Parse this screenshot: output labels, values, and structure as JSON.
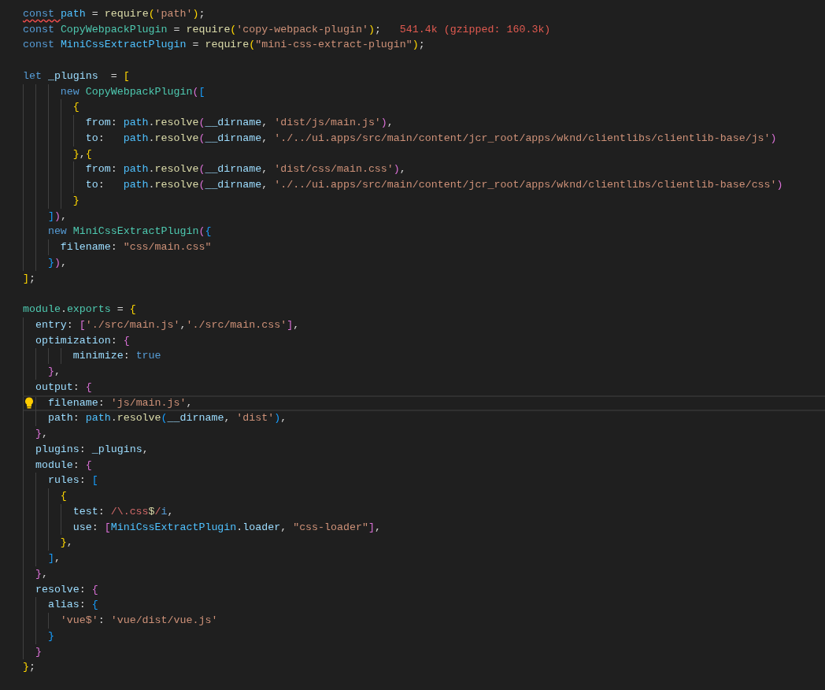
{
  "editor": {
    "blocks": [
      {
        "lines": [
          {
            "tokens": [
              {
                "text": "const ",
                "kind": "kw",
                "error": true
              },
              {
                "text": "path",
                "kind": "cvar"
              },
              {
                "text": " = ",
                "kind": "p"
              },
              {
                "text": "require",
                "kind": "fn"
              },
              {
                "text": "(",
                "kind": "y"
              },
              {
                "text": "'path'",
                "kind": "str"
              },
              {
                "text": ")",
                "kind": "y"
              },
              {
                "text": ";",
                "kind": "p"
              }
            ]
          },
          {
            "tokens": [
              {
                "text": "const ",
                "kind": "kw"
              },
              {
                "text": "CopyWebpackPlugin",
                "kind": "cls"
              },
              {
                "text": " = ",
                "kind": "p"
              },
              {
                "text": "require",
                "kind": "fn"
              },
              {
                "text": "(",
                "kind": "y"
              },
              {
                "text": "'copy-webpack-plugin'",
                "kind": "str"
              },
              {
                "text": ")",
                "kind": "y"
              },
              {
                "text": ";",
                "kind": "p"
              }
            ],
            "annotation": "541.4k (gzipped: 160.3k)"
          },
          {
            "tokens": [
              {
                "text": "const ",
                "kind": "kw"
              },
              {
                "text": "MiniCssExtractPlugin",
                "kind": "cvar"
              },
              {
                "text": " = ",
                "kind": "p"
              },
              {
                "text": "require",
                "kind": "fn"
              },
              {
                "text": "(",
                "kind": "y"
              },
              {
                "text": "\"mini-css-extract-plugin\"",
                "kind": "str"
              },
              {
                "text": ")",
                "kind": "y"
              },
              {
                "text": ";",
                "kind": "p"
              }
            ]
          }
        ]
      },
      {
        "lines": [
          {
            "tokens": [
              {
                "text": "let ",
                "kind": "kw"
              },
              {
                "text": "_plugins",
                "kind": "prop"
              },
              {
                "text": "  = ",
                "kind": "p"
              },
              {
                "text": "[",
                "kind": "y"
              }
            ]
          },
          {
            "tokens": [
              {
                "text": "      new ",
                "kind": "kw"
              },
              {
                "text": "CopyWebpackPlugin",
                "kind": "cls"
              },
              {
                "text": "(",
                "kind": "m"
              },
              {
                "text": "[",
                "kind": "b"
              }
            ]
          },
          {
            "tokens": [
              {
                "text": "        {",
                "kind": "y"
              }
            ]
          },
          {
            "tokens": [
              {
                "text": "          from",
                "kind": "prop"
              },
              {
                "text": ": ",
                "kind": "p"
              },
              {
                "text": "path",
                "kind": "cvar"
              },
              {
                "text": ".",
                "kind": "p"
              },
              {
                "text": "resolve",
                "kind": "fn"
              },
              {
                "text": "(",
                "kind": "m"
              },
              {
                "text": "__dirname",
                "kind": "prop"
              },
              {
                "text": ", ",
                "kind": "p"
              },
              {
                "text": "'dist/js/main.js'",
                "kind": "str"
              },
              {
                "text": ")",
                "kind": "m"
              },
              {
                "text": ",",
                "kind": "p"
              }
            ]
          },
          {
            "tokens": [
              {
                "text": "          to",
                "kind": "prop"
              },
              {
                "text": ":   ",
                "kind": "p"
              },
              {
                "text": "path",
                "kind": "cvar"
              },
              {
                "text": ".",
                "kind": "p"
              },
              {
                "text": "resolve",
                "kind": "fn"
              },
              {
                "text": "(",
                "kind": "m"
              },
              {
                "text": "__dirname",
                "kind": "prop"
              },
              {
                "text": ", ",
                "kind": "p"
              },
              {
                "text": "'./../ui.apps/src/main/content/jcr_root/apps/wknd/clientlibs/clientlib-base/js'",
                "kind": "str"
              },
              {
                "text": ")",
                "kind": "m"
              }
            ]
          },
          {
            "tokens": [
              {
                "text": "        }",
                "kind": "y"
              },
              {
                "text": ",",
                "kind": "p"
              },
              {
                "text": "{",
                "kind": "y"
              }
            ]
          },
          {
            "tokens": [
              {
                "text": "          from",
                "kind": "prop"
              },
              {
                "text": ": ",
                "kind": "p"
              },
              {
                "text": "path",
                "kind": "cvar"
              },
              {
                "text": ".",
                "kind": "p"
              },
              {
                "text": "resolve",
                "kind": "fn"
              },
              {
                "text": "(",
                "kind": "m"
              },
              {
                "text": "__dirname",
                "kind": "prop"
              },
              {
                "text": ", ",
                "kind": "p"
              },
              {
                "text": "'dist/css/main.css'",
                "kind": "str"
              },
              {
                "text": ")",
                "kind": "m"
              },
              {
                "text": ",",
                "kind": "p"
              }
            ]
          },
          {
            "tokens": [
              {
                "text": "          to",
                "kind": "prop"
              },
              {
                "text": ":   ",
                "kind": "p"
              },
              {
                "text": "path",
                "kind": "cvar"
              },
              {
                "text": ".",
                "kind": "p"
              },
              {
                "text": "resolve",
                "kind": "fn"
              },
              {
                "text": "(",
                "kind": "m"
              },
              {
                "text": "__dirname",
                "kind": "prop"
              },
              {
                "text": ", ",
                "kind": "p"
              },
              {
                "text": "'./../ui.apps/src/main/content/jcr_root/apps/wknd/clientlibs/clientlib-base/css'",
                "kind": "str"
              },
              {
                "text": ")",
                "kind": "m"
              }
            ]
          },
          {
            "tokens": [
              {
                "text": "        }",
                "kind": "y"
              }
            ]
          },
          {
            "tokens": [
              {
                "text": "    ]",
                "kind": "b"
              },
              {
                "text": ")",
                "kind": "m"
              },
              {
                "text": ",",
                "kind": "p"
              }
            ]
          },
          {
            "tokens": [
              {
                "text": "    new ",
                "kind": "kw"
              },
              {
                "text": "MiniCssExtractPlugin",
                "kind": "cls"
              },
              {
                "text": "(",
                "kind": "m"
              },
              {
                "text": "{",
                "kind": "b"
              }
            ]
          },
          {
            "tokens": [
              {
                "text": "      filename",
                "kind": "prop"
              },
              {
                "text": ": ",
                "kind": "p"
              },
              {
                "text": "\"css/main.css\"",
                "kind": "str"
              }
            ]
          },
          {
            "tokens": [
              {
                "text": "    }",
                "kind": "b"
              },
              {
                "text": ")",
                "kind": "m"
              },
              {
                "text": ",",
                "kind": "p"
              }
            ]
          },
          {
            "tokens": [
              {
                "text": "]",
                "kind": "y"
              },
              {
                "text": ";",
                "kind": "p"
              }
            ]
          }
        ]
      },
      {
        "lines": [
          {
            "tokens": [
              {
                "text": "module",
                "kind": "cls"
              },
              {
                "text": ".",
                "kind": "p"
              },
              {
                "text": "exports",
                "kind": "cls"
              },
              {
                "text": " = ",
                "kind": "p"
              },
              {
                "text": "{",
                "kind": "y"
              }
            ]
          },
          {
            "tokens": [
              {
                "text": "  entry",
                "kind": "prop"
              },
              {
                "text": ": ",
                "kind": "p"
              },
              {
                "text": "[",
                "kind": "m"
              },
              {
                "text": "'./src/main.js'",
                "kind": "str"
              },
              {
                "text": ",",
                "kind": "p"
              },
              {
                "text": "'./src/main.css'",
                "kind": "str"
              },
              {
                "text": "]",
                "kind": "m"
              },
              {
                "text": ",",
                "kind": "p"
              }
            ]
          },
          {
            "tokens": [
              {
                "text": "  optimization",
                "kind": "prop"
              },
              {
                "text": ": ",
                "kind": "p"
              },
              {
                "text": "{",
                "kind": "m"
              }
            ]
          },
          {
            "tokens": [
              {
                "text": "        minimize",
                "kind": "prop"
              },
              {
                "text": ": ",
                "kind": "p"
              },
              {
                "text": "true",
                "kind": "kw"
              }
            ]
          },
          {
            "tokens": [
              {
                "text": "    }",
                "kind": "m"
              },
              {
                "text": ",",
                "kind": "p"
              }
            ]
          },
          {
            "tokens": [
              {
                "text": "  output",
                "kind": "prop"
              },
              {
                "text": ": ",
                "kind": "p"
              },
              {
                "text": "{",
                "kind": "m"
              }
            ]
          },
          {
            "current": true,
            "tokens": [
              {
                "text": "    filename",
                "kind": "prop"
              },
              {
                "text": ": ",
                "kind": "p"
              },
              {
                "text": "'js/main.js'",
                "kind": "str"
              },
              {
                "text": ",",
                "kind": "p"
              }
            ]
          },
          {
            "tokens": [
              {
                "text": "    path",
                "kind": "prop"
              },
              {
                "text": ": ",
                "kind": "p"
              },
              {
                "text": "path",
                "kind": "cvar"
              },
              {
                "text": ".",
                "kind": "p"
              },
              {
                "text": "resolve",
                "kind": "fn"
              },
              {
                "text": "(",
                "kind": "b"
              },
              {
                "text": "__dirname",
                "kind": "prop"
              },
              {
                "text": ", ",
                "kind": "p"
              },
              {
                "text": "'dist'",
                "kind": "str"
              },
              {
                "text": ")",
                "kind": "b"
              },
              {
                "text": ",",
                "kind": "p"
              }
            ]
          },
          {
            "tokens": [
              {
                "text": "  }",
                "kind": "m"
              },
              {
                "text": ",",
                "kind": "p"
              }
            ]
          },
          {
            "tokens": [
              {
                "text": "  plugins",
                "kind": "prop"
              },
              {
                "text": ": ",
                "kind": "p"
              },
              {
                "text": "_plugins",
                "kind": "prop"
              },
              {
                "text": ",",
                "kind": "p"
              }
            ]
          },
          {
            "tokens": [
              {
                "text": "  module",
                "kind": "prop"
              },
              {
                "text": ": ",
                "kind": "p"
              },
              {
                "text": "{",
                "kind": "m"
              }
            ]
          },
          {
            "tokens": [
              {
                "text": "    rules",
                "kind": "prop"
              },
              {
                "text": ": ",
                "kind": "p"
              },
              {
                "text": "[",
                "kind": "b"
              }
            ]
          },
          {
            "tokens": [
              {
                "text": "      {",
                "kind": "y"
              }
            ]
          },
          {
            "tokens": [
              {
                "text": "        test",
                "kind": "prop"
              },
              {
                "text": ": ",
                "kind": "p"
              },
              {
                "text": "/\\.css",
                "kind": "re"
              },
              {
                "text": "$",
                "kind": "fn"
              },
              {
                "text": "/",
                "kind": "re"
              },
              {
                "text": "i",
                "kind": "kw"
              },
              {
                "text": ",",
                "kind": "p"
              }
            ]
          },
          {
            "tokens": [
              {
                "text": "        use",
                "kind": "prop"
              },
              {
                "text": ": ",
                "kind": "p"
              },
              {
                "text": "[",
                "kind": "m"
              },
              {
                "text": "MiniCssExtractPlugin",
                "kind": "cvar"
              },
              {
                "text": ".",
                "kind": "p"
              },
              {
                "text": "loader",
                "kind": "prop"
              },
              {
                "text": ", ",
                "kind": "p"
              },
              {
                "text": "\"css-loader\"",
                "kind": "str"
              },
              {
                "text": "]",
                "kind": "m"
              },
              {
                "text": ",",
                "kind": "p"
              }
            ]
          },
          {
            "tokens": [
              {
                "text": "      }",
                "kind": "y"
              },
              {
                "text": ",",
                "kind": "p"
              }
            ]
          },
          {
            "tokens": [
              {
                "text": "    ]",
                "kind": "b"
              },
              {
                "text": ",",
                "kind": "p"
              }
            ]
          },
          {
            "tokens": [
              {
                "text": "  }",
                "kind": "m"
              },
              {
                "text": ",",
                "kind": "p"
              }
            ]
          },
          {
            "tokens": [
              {
                "text": "  resolve",
                "kind": "prop"
              },
              {
                "text": ": ",
                "kind": "p"
              },
              {
                "text": "{",
                "kind": "m"
              }
            ]
          },
          {
            "tokens": [
              {
                "text": "    alias",
                "kind": "prop"
              },
              {
                "text": ": ",
                "kind": "p"
              },
              {
                "text": "{",
                "kind": "b"
              }
            ]
          },
          {
            "tokens": [
              {
                "text": "      'vue$'",
                "kind": "str"
              },
              {
                "text": ": ",
                "kind": "p"
              },
              {
                "text": "'vue/dist/vue.js'",
                "kind": "str"
              }
            ]
          },
          {
            "tokens": [
              {
                "text": "    }",
                "kind": "b"
              }
            ]
          },
          {
            "tokens": [
              {
                "text": "  }",
                "kind": "m"
              }
            ]
          },
          {
            "tokens": [
              {
                "text": "}",
                "kind": "y"
              },
              {
                "text": ";",
                "kind": "p"
              }
            ]
          }
        ]
      }
    ]
  }
}
